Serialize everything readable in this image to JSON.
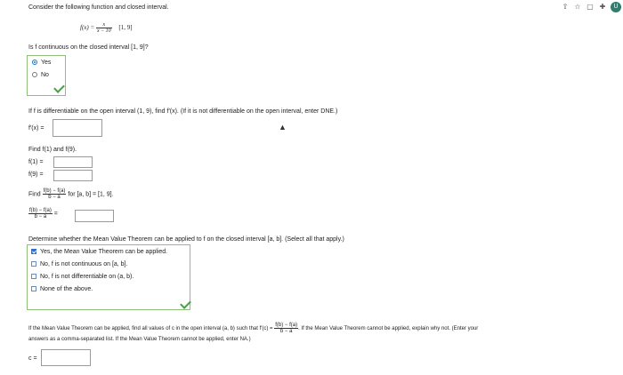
{
  "browser_icons": {
    "share": "⇧",
    "star": "☆",
    "window": "▢",
    "puzzle": "✚",
    "avatar": "U"
  },
  "intro": "Consider the following function and closed interval.",
  "function": {
    "lhs": "f(x) =",
    "num": "x",
    "den": "x − 10",
    "interval": "[1, 9]"
  },
  "q1": {
    "question": "Is f continuous on the closed interval [1, 9]?",
    "options": [
      "Yes",
      "No"
    ],
    "selected": 0
  },
  "q2": {
    "question": "If f is differentiable on the open interval (1, 9), find f′(x). (If it is not differentiable on the open interval, enter DNE.)",
    "label": "f′(x) =",
    "value": ""
  },
  "q3": {
    "heading": "Find f(1) and f(9).",
    "f1_label": "f(1) =",
    "f9_label": "f(9) =",
    "f1_value": "",
    "f9_value": ""
  },
  "q4": {
    "find": "Find",
    "frac_num": "f(b) − f(a)",
    "frac_den": "b − a",
    "condition": "for [a, b] = [1, 9].",
    "answer_eq": "=",
    "value": ""
  },
  "q5": {
    "question": "Determine whether the Mean Value Theorem can be applied to f on the closed interval [a, b]. (Select all that apply.)",
    "options": [
      "Yes, the Mean Value Theorem can be applied.",
      "No, f is not continuous on [a, b].",
      "No, f is not differentiable on (a, b).",
      "None of the above."
    ],
    "checked": [
      true,
      false,
      false,
      false
    ]
  },
  "q6": {
    "text_a": "If the Mean Value Theorem can be applied, find all values of c in the open interval (a, b) such that f′(c) =",
    "frac_num": "f(b) − f(a)",
    "frac_den": "b − a",
    "text_b": ". If the Mean Value Theorem cannot be applied, explain why not. (Enter your",
    "text_c": "answers as a comma-separated list. If the Mean Value Theorem cannot be applied, enter NA.)",
    "label": "c =",
    "value": ""
  }
}
